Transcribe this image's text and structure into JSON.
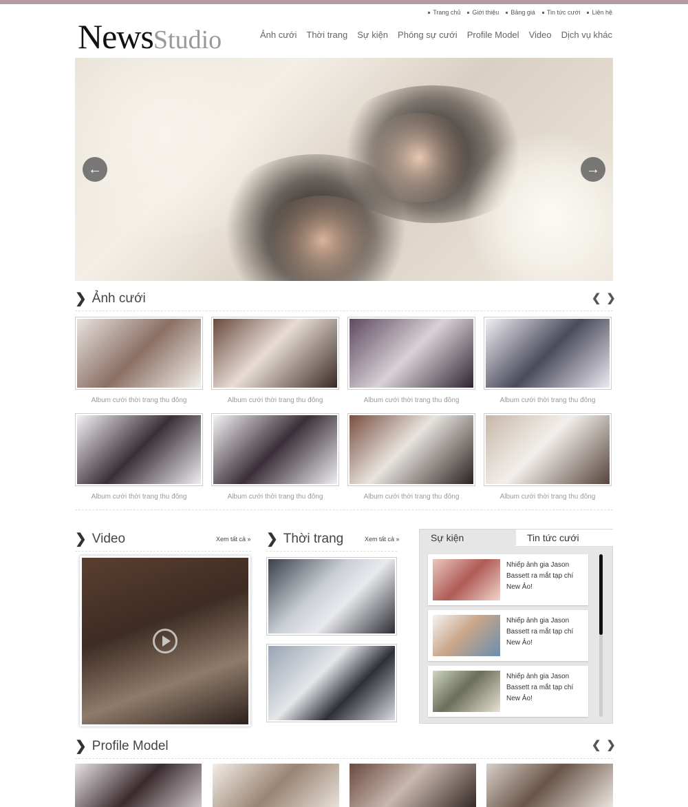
{
  "top_links": [
    "Trang chủ",
    "Giới thiệu",
    "Bảng giá",
    "Tin tức cưới",
    "Liên hệ"
  ],
  "logo": {
    "part1": "News",
    "part2": "Studio"
  },
  "main_nav": [
    "Ảnh cưới",
    "Thời trang",
    "Sự kiện",
    "Phóng sự cưới",
    "Profile Model",
    "Video",
    "Dịch vụ khác"
  ],
  "slider": {
    "prev_icon": "←",
    "next_icon": "→"
  },
  "anh_cuoi": {
    "title": "Ảnh cưới",
    "prev": "❮",
    "next": "❯",
    "albums": [
      "Album cưới thời trang thu đông",
      "Album cưới thời trang thu đông",
      "Album cưới thời trang thu đông",
      "Album cưới thời trang thu đông",
      "Album cưới thời trang thu đông",
      "Album cưới thời trang thu đông",
      "Album cưới thời trang thu đông",
      "Album cưới thời trang thu đông"
    ]
  },
  "video": {
    "title": "Video",
    "see_all": "Xem tất cả »"
  },
  "thoi_trang": {
    "title": "Thời trang",
    "see_all": "Xem tất cả »"
  },
  "tabs": {
    "tab1": "Sự kiện",
    "tab2": "Tin tức cưới",
    "items": [
      "Nhiếp ảnh gia Jason Bassett ra mắt tạp chí New Ảo!",
      "Nhiếp ảnh gia Jason Bassett ra mắt tạp chí New Ảo!",
      "Nhiếp ảnh gia Jason Bassett ra mắt tạp chí New Ảo!"
    ]
  },
  "profile": {
    "title": "Profile Model",
    "prev": "❮",
    "next": "❯"
  },
  "colors": {
    "topbar": "#b49aa2",
    "text": "#555555",
    "tab_bg": "#e6e6e6"
  }
}
